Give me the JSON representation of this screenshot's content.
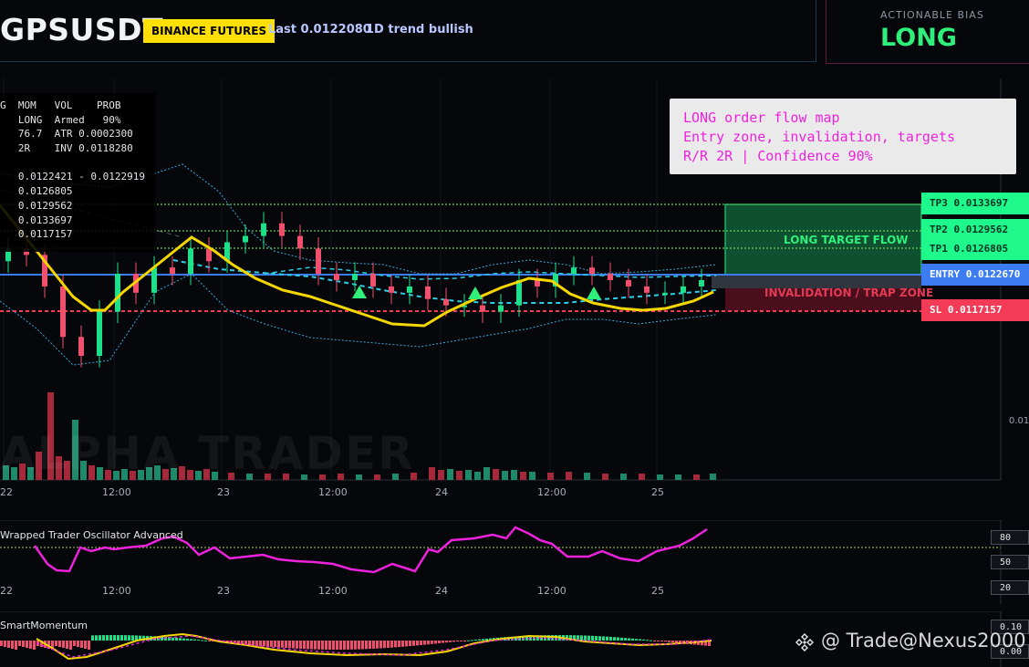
{
  "header": {
    "symbol": "GPSUSDT",
    "exchange_badge": "BINANCE FUTURES",
    "last": "Last 0.0122080",
    "trend": "1D trend bullish",
    "bias_label": "ACTIONABLE BIAS",
    "bias_value": "LONG"
  },
  "stats_table": [
    "G  MOM   VOL    PROB",
    "   LONG  Armed   90%",
    "   76.7  ATR 0.0002300",
    "   2R    INV 0.0118280",
    "",
    "   0.0122421 - 0.0122919",
    "   0.0126805",
    "   0.0129562",
    "   0.0133697",
    "   0.0117157"
  ],
  "note": {
    "line1": "LONG order flow map",
    "line2": "Entry zone, invalidation, targets",
    "line3": "R/R 2R | Confidence 90%"
  },
  "levels": {
    "tp3": "TP3 0.0133697",
    "tp2": "TP2 0.0129562",
    "tp1": "TP1 0.0126805",
    "entry": "ENTRY 0.0122670",
    "sl": "SL 0.0117157",
    "flow_label": "LONG TARGET FLOW",
    "trap_label": "INVALIDATION / TRAP ZONE"
  },
  "price_axis": {
    "tick": "0.01"
  },
  "watermark": "ALPHA TRADER",
  "x_axis": [
    "22",
    "12:00",
    "23",
    "12:00",
    "24",
    "12:00",
    "25"
  ],
  "oscillator": {
    "title": "Wrapped Trader Oscillator Advanced",
    "levels": [
      "80",
      "50",
      "20"
    ]
  },
  "momentum": {
    "title": "SmartMomentum",
    "levels": [
      "0.10",
      "0.00"
    ]
  },
  "credit": "@ Trade@Nexus2000",
  "colors": {
    "long": "#2ef07a",
    "short": "#f33b57",
    "entry": "#3b7cf2",
    "accent": "#ffe000",
    "magenta": "#ee22dd"
  },
  "chart_data": {
    "type": "candlestick",
    "ylim_note": "price axis tick 0.01",
    "closes": [
      0.0127,
      0.0126,
      0.0121,
      0.0113,
      0.011,
      0.0117,
      0.0123,
      0.012,
      0.0124,
      0.0123,
      0.0127,
      0.0125,
      0.0128,
      0.0129,
      0.0131,
      0.0129,
      0.0127,
      0.0123,
      0.0122,
      0.0123,
      0.0121,
      0.012,
      0.0121,
      0.0119,
      0.0118,
      0.0118,
      0.0117,
      0.0118,
      0.0122,
      0.0121,
      0.0123,
      0.0124,
      0.0123,
      0.0122,
      0.0121,
      0.012,
      0.012,
      0.0121,
      0.0122
    ]
  }
}
